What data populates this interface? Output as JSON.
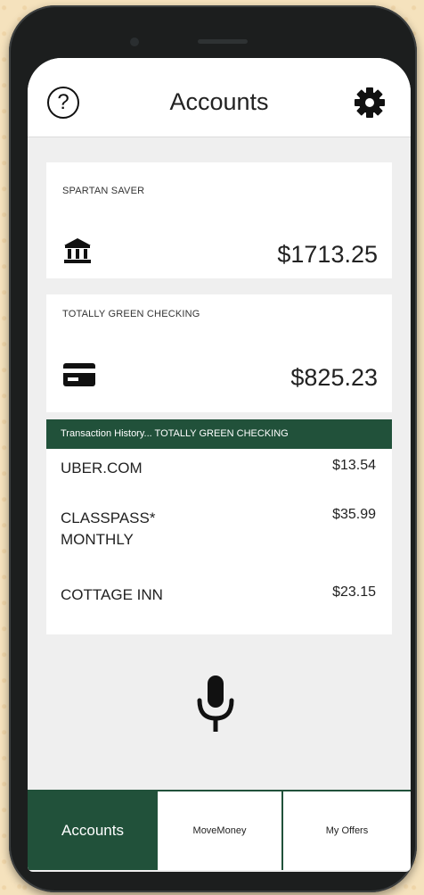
{
  "header": {
    "title": "Accounts",
    "help_glyph": "?",
    "help_icon": "question-circle-icon",
    "settings_icon": "gear-icon"
  },
  "accounts": [
    {
      "name": "SPARTAN SAVER",
      "icon": "bank-icon",
      "balance": "$1713.25"
    },
    {
      "name": "TOTALLY GREEN CHECKING",
      "icon": "credit-card-icon",
      "balance": "$825.23"
    }
  ],
  "transactions": {
    "header": "Transaction History... TOTALLY GREEN CHECKING",
    "items": [
      {
        "merchant": "UBER.COM",
        "amount": "$13.54"
      },
      {
        "merchant": "CLASSPASS* MONTHLY",
        "amount": "$35.99"
      },
      {
        "merchant": "COTTAGE INN",
        "amount": "$23.15"
      }
    ]
  },
  "voice": {
    "icon": "microphone-icon"
  },
  "tabs": [
    {
      "label": "Accounts",
      "active": true
    },
    {
      "label": "MoveMoney",
      "active": false
    },
    {
      "label": "My Offers",
      "active": false
    }
  ],
  "colors": {
    "brand_green": "#21513a",
    "background": "#efefef",
    "surface": "#ffffff"
  }
}
